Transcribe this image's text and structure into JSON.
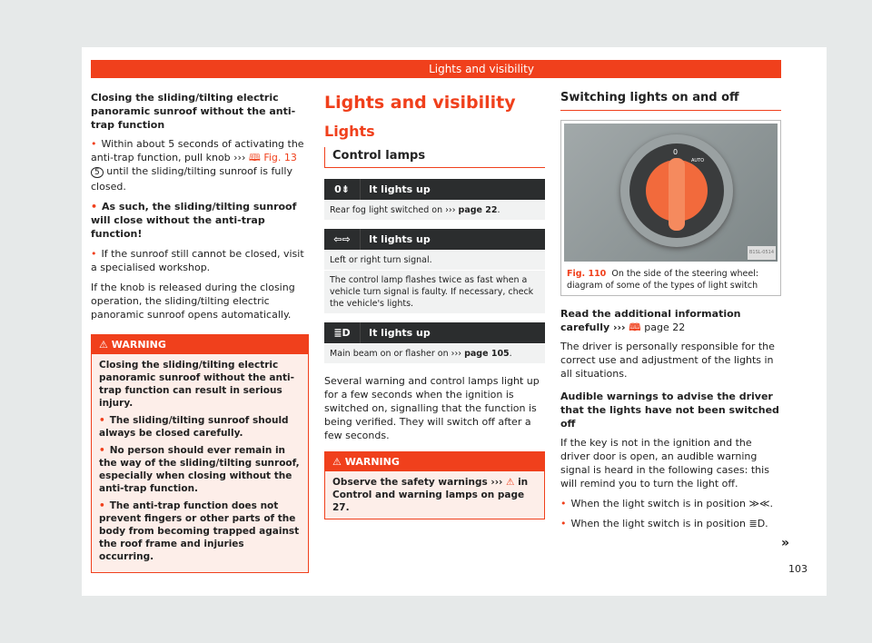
{
  "header": {
    "title": "Lights and visibility"
  },
  "left": {
    "heading": "Closing the sliding/tilting electric panoramic sunroof without the anti-trap function",
    "b1_pre": "Within about 5 seconds of activating the anti-trap function, pull knob ››› ",
    "b1_fig": "Fig. 13",
    "b1_num": "5",
    "b1_post": " until the sliding/tilting sunroof is fully closed.",
    "b2": "As such, the sliding/tilting sunroof will close without the anti-trap function!",
    "b3": "If the sunroof still cannot be closed, visit a specialised workshop.",
    "para": "If the knob is released during the closing operation, the sliding/tilting electric panoramic sunroof opens automatically.",
    "warning": {
      "title": "WARNING",
      "intro": "Closing the sliding/tilting electric panoramic sunroof without the anti-trap function can result in serious injury.",
      "items": [
        "The sliding/tilting sunroof should always be closed carefully.",
        "No person should ever remain in the way of the sliding/tilting sunroof, especially when closing without the anti-trap function.",
        "The anti-trap function does not prevent fingers or other parts of the body from becoming trapped against the roof frame and injuries occurring."
      ]
    }
  },
  "middle": {
    "title": "Lights and visibility",
    "subtitle": "Lights",
    "section": "Control lamps",
    "lamps": [
      {
        "icon": "rear-fog-light",
        "label": "It lights up",
        "text": "Rear fog light switched on ››› ",
        "ref": "page 22",
        "after": "."
      },
      {
        "icon": "turn-signal",
        "label": "It lights up",
        "text": "Left or right turn signal.",
        "ref": "",
        "after": "",
        "extra": "The control lamp flashes twice as fast when a vehicle turn signal is faulty. If necessary, check the vehicle's lights."
      },
      {
        "icon": "main-beam",
        "label": "It lights up",
        "text": "Main beam on or flasher on ››› ",
        "ref": "page 105",
        "after": "."
      }
    ],
    "para": "Several warning and control lamps light up for a few seconds when the ignition is switched on, signalling that the function is being verified. They will switch off after a few seconds.",
    "warning": {
      "title": "WARNING",
      "text_pre": "Observe the safety warnings ››› ",
      "text_post": " in Control and warning lamps on page 27."
    }
  },
  "right": {
    "section": "Switching lights on and off",
    "figure": {
      "code": "B1SL-0514",
      "labels": [
        "0",
        "AUTO"
      ],
      "fig": "Fig. 110",
      "caption": "On the side of the steering wheel: diagram of some of the types of light switch"
    },
    "read_pre": "Read the additional information carefully ››› ",
    "read_ref": "page 22",
    "para1": "The driver is personally responsible for the correct use and adjustment of the lights in all situations.",
    "heading2": "Audible warnings to advise the driver that the lights have not been switched off",
    "para2": "If the key is not in the ignition and the driver door is open, an audible warning signal is heard in the following cases: this will remind you to turn the light off.",
    "b1": "When the light switch is in position ≫≪.",
    "b2": "When the light switch is in position ≣D.",
    "continue": "»"
  },
  "page_number": "103",
  "colors": {
    "accent": "#f0401c",
    "dark": "#2b2d2e"
  }
}
